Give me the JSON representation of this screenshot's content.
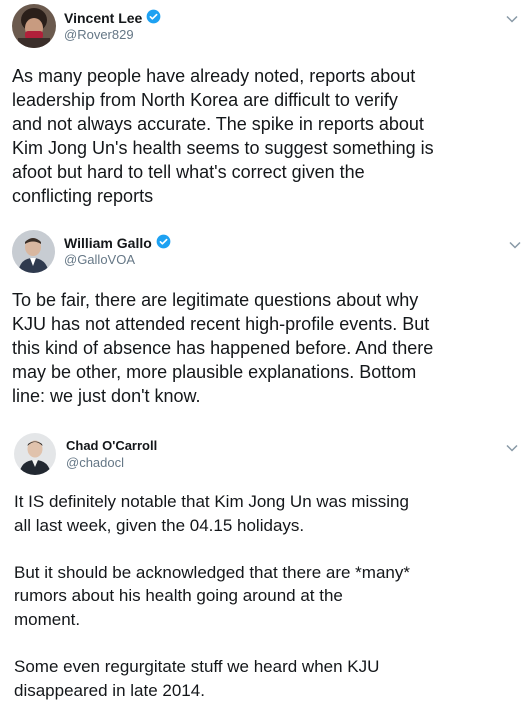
{
  "tweets": [
    {
      "name": "Vincent Lee",
      "handle": "@Rover829",
      "verified": true,
      "text": "As many people have already noted, reports about\nleadership from North Korea are difficult to verify\nand not always accurate. The spike in reports about\nKim Jong Un's health seems to suggest something is\nafoot but hard to tell what's correct given the\nconflicting reports"
    },
    {
      "name": "William Gallo",
      "handle": "@GalloVOA",
      "verified": true,
      "text": "To be fair, there are legitimate questions about why\nKJU has not attended recent high-profile events. But\nthis kind of absence has happened before. And there\nmay be other, more plausible explanations. Bottom\nline: we just don't know."
    },
    {
      "name": "Chad O'Carroll",
      "handle": "@chadocl",
      "verified": false,
      "text": "It IS definitely notable that Kim Jong Un was missing\nall last week, given the 04.15 holidays.\n\nBut it should be acknowledged that there are *many*\nrumors about his health going around at the\nmoment.\n\nSome even regurgitate stuff we heard when KJU\ndisappeared in late 2014."
    }
  ],
  "colors": {
    "verified": "#1da1f2",
    "handle": "#657786",
    "text": "#14171a"
  },
  "icons": [
    "verified-badge-icon",
    "chevron-down-icon"
  ]
}
